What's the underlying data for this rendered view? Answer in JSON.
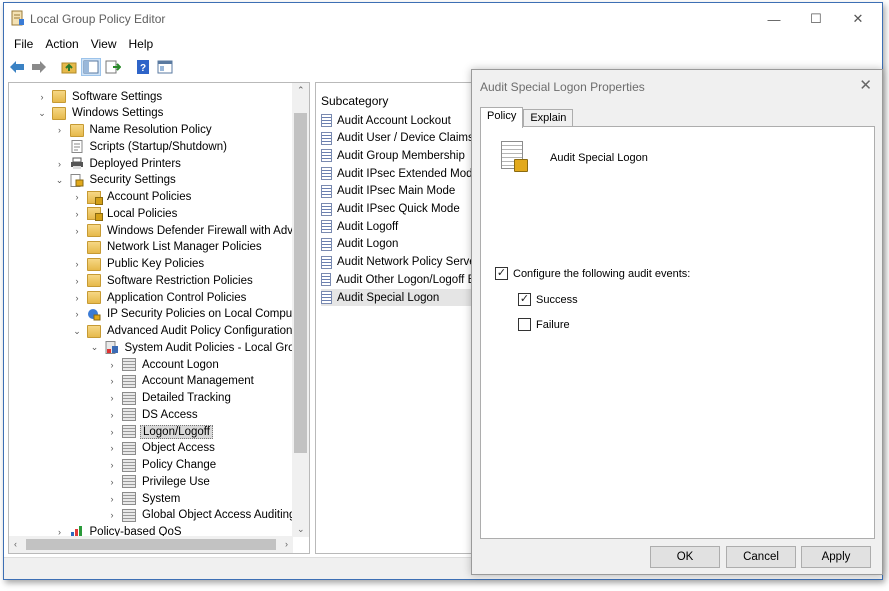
{
  "window": {
    "title": "Local Group Policy Editor",
    "controls": {
      "minimize": "—",
      "maximize": "☐",
      "close": "✕"
    }
  },
  "menu": [
    "File",
    "Action",
    "View",
    "Help"
  ],
  "toolbar": [
    "back-icon",
    "forward-icon",
    "up-folder-icon",
    "show-hide-tree-icon",
    "export-list-icon",
    "help-icon",
    "properties-icon"
  ],
  "tree": [
    {
      "label": "Software Settings",
      "indent": 0,
      "expander": "›",
      "icon": "folder"
    },
    {
      "label": "Windows Settings",
      "indent": 0,
      "expander": "⌄",
      "icon": "folder"
    },
    {
      "label": "Name Resolution Policy",
      "indent": 1,
      "expander": "›",
      "icon": "folder"
    },
    {
      "label": "Scripts (Startup/Shutdown)",
      "indent": 1,
      "expander": "",
      "icon": "script"
    },
    {
      "label": "Deployed Printers",
      "indent": 1,
      "expander": "›",
      "icon": "printer"
    },
    {
      "label": "Security Settings",
      "indent": 1,
      "expander": "⌄",
      "icon": "security"
    },
    {
      "label": "Account Policies",
      "indent": 2,
      "expander": "›",
      "icon": "folder-lock"
    },
    {
      "label": "Local Policies",
      "indent": 2,
      "expander": "›",
      "icon": "folder-lock"
    },
    {
      "label": "Windows Defender Firewall with Advanc",
      "indent": 2,
      "expander": "›",
      "icon": "folder"
    },
    {
      "label": "Network List Manager Policies",
      "indent": 2,
      "expander": "",
      "icon": "folder"
    },
    {
      "label": "Public Key Policies",
      "indent": 2,
      "expander": "›",
      "icon": "folder"
    },
    {
      "label": "Software Restriction Policies",
      "indent": 2,
      "expander": "›",
      "icon": "folder"
    },
    {
      "label": "Application Control Policies",
      "indent": 2,
      "expander": "›",
      "icon": "folder"
    },
    {
      "label": "IP Security Policies on Local Computer",
      "indent": 2,
      "expander": "›",
      "icon": "ipsec"
    },
    {
      "label": "Advanced Audit Policy Configuration",
      "indent": 2,
      "expander": "⌄",
      "icon": "folder"
    },
    {
      "label": "System Audit Policies - Local Group",
      "indent": 3,
      "expander": "⌄",
      "icon": "audit-root"
    },
    {
      "label": "Account Logon",
      "indent": 4,
      "expander": "›",
      "icon": "audit"
    },
    {
      "label": "Account Management",
      "indent": 4,
      "expander": "›",
      "icon": "audit"
    },
    {
      "label": "Detailed Tracking",
      "indent": 4,
      "expander": "›",
      "icon": "audit"
    },
    {
      "label": "DS Access",
      "indent": 4,
      "expander": "›",
      "icon": "audit"
    },
    {
      "label": "Logon/Logoff",
      "indent": 4,
      "expander": "›",
      "icon": "audit",
      "selected": true
    },
    {
      "label": "Object Access",
      "indent": 4,
      "expander": "›",
      "icon": "audit"
    },
    {
      "label": "Policy Change",
      "indent": 4,
      "expander": "›",
      "icon": "audit"
    },
    {
      "label": "Privilege Use",
      "indent": 4,
      "expander": "›",
      "icon": "audit"
    },
    {
      "label": "System",
      "indent": 4,
      "expander": "›",
      "icon": "audit"
    },
    {
      "label": "Global Object Access Auditing",
      "indent": 4,
      "expander": "›",
      "icon": "audit"
    },
    {
      "label": "Policy-based QoS",
      "indent": 1,
      "expander": "›",
      "icon": "qos"
    }
  ],
  "list": {
    "header": "Subcategory",
    "items": [
      {
        "label": "Audit Account Lockout"
      },
      {
        "label": "Audit User / Device Claims"
      },
      {
        "label": "Audit Group Membership"
      },
      {
        "label": "Audit IPsec Extended Mode"
      },
      {
        "label": "Audit IPsec Main Mode"
      },
      {
        "label": "Audit IPsec Quick Mode"
      },
      {
        "label": "Audit Logoff"
      },
      {
        "label": "Audit Logon"
      },
      {
        "label": "Audit Network Policy Server"
      },
      {
        "label": "Audit Other Logon/Logoff Ev"
      },
      {
        "label": "Audit Special Logon",
        "selected": true
      }
    ]
  },
  "dialog": {
    "title": "Audit Special Logon Properties",
    "close": "✕",
    "tabs": [
      "Policy",
      "Explain"
    ],
    "active_tab": "Policy",
    "policy_name": "Audit Special Logon",
    "configure_label": "Configure the following audit events:",
    "configure_checked": true,
    "success_label": "Success",
    "success_checked": true,
    "failure_label": "Failure",
    "failure_checked": false,
    "buttons": {
      "ok": "OK",
      "cancel": "Cancel",
      "apply": "Apply"
    }
  },
  "colors": {
    "window_border": "#3d6fb4",
    "selection": "#e5e5e5",
    "dialog_bg": "#f0f0f0"
  }
}
